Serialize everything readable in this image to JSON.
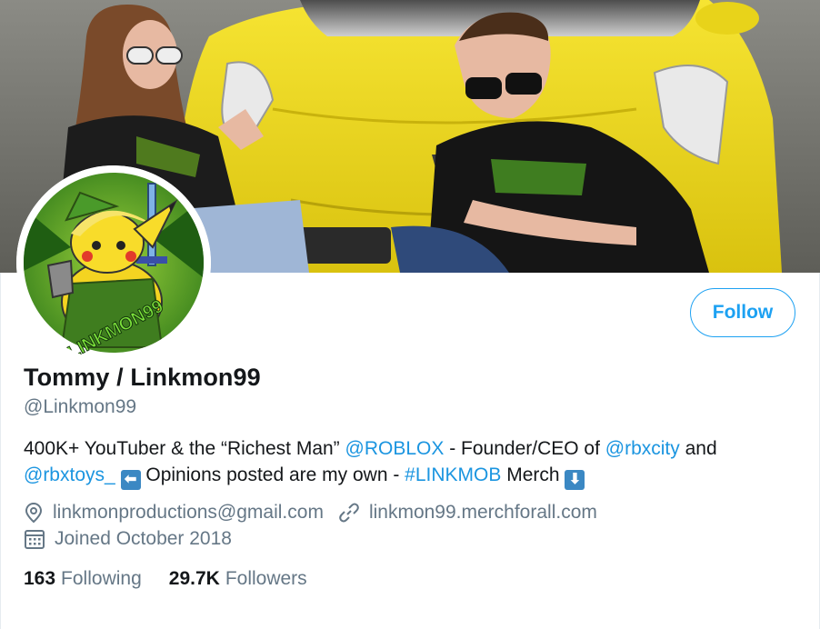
{
  "profile": {
    "display_name": "Tommy / Linkmon99",
    "handle": "@Linkmon99",
    "follow_label": "Follow",
    "avatar_text": "LINKMON99"
  },
  "bio": {
    "part1": "400K+ YouTuber & the “Richest Man” ",
    "mention_roblox": "@ROBLOX",
    "part2": " - Founder/CEO of ",
    "mention_rbxcity": "@rbxcity",
    "part3": " and ",
    "mention_rbxtoys": "@rbxtoys_",
    "part4": " Opinions posted are my own - ",
    "hashtag": "#LINKMOB",
    "part5": " Merch ",
    "emoji_left": "⬅",
    "emoji_down": "⬇"
  },
  "meta": {
    "location": "linkmonproductions@gmail.com",
    "website": "linkmon99.merchforall.com",
    "joined": "Joined October 2018"
  },
  "stats": {
    "following_count": "163",
    "following_label": "Following",
    "followers_count": "29.7K",
    "followers_label": "Followers"
  },
  "colors": {
    "accent": "#1da1f2",
    "link": "#1b95e0",
    "secondary_text": "#657786",
    "car_yellow": "#f2de1a"
  },
  "icons": {
    "location": "location-pin-icon",
    "website": "link-icon",
    "joined": "calendar-icon"
  }
}
